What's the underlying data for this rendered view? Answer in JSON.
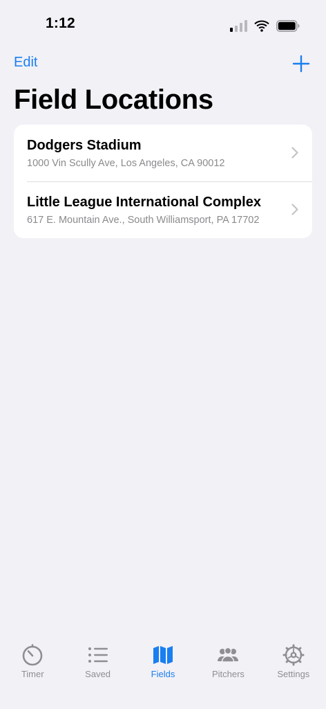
{
  "status_bar": {
    "time": "1:12"
  },
  "nav": {
    "edit_label": "Edit",
    "add_icon": "plus-icon",
    "title": "Field Locations"
  },
  "fields": [
    {
      "name": "Dodgers Stadium",
      "address": "1000 Vin Scully Ave, Los Angeles, CA  90012"
    },
    {
      "name": "Little League International Complex",
      "address": "617 E. Mountain Ave., South Williamsport, PA 17702"
    }
  ],
  "tab_bar": {
    "active": "fields",
    "tabs": [
      {
        "id": "timer",
        "label": "Timer",
        "icon": "stopwatch-icon"
      },
      {
        "id": "saved",
        "label": "Saved",
        "icon": "list-icon"
      },
      {
        "id": "fields",
        "label": "Fields",
        "icon": "map-icon"
      },
      {
        "id": "pitchers",
        "label": "Pitchers",
        "icon": "people-icon"
      },
      {
        "id": "settings",
        "label": "Settings",
        "icon": "gear-icon"
      }
    ]
  },
  "colors": {
    "accent": "#1a7ff0",
    "background": "#f2f1f6",
    "inactive": "#8e8e93"
  }
}
